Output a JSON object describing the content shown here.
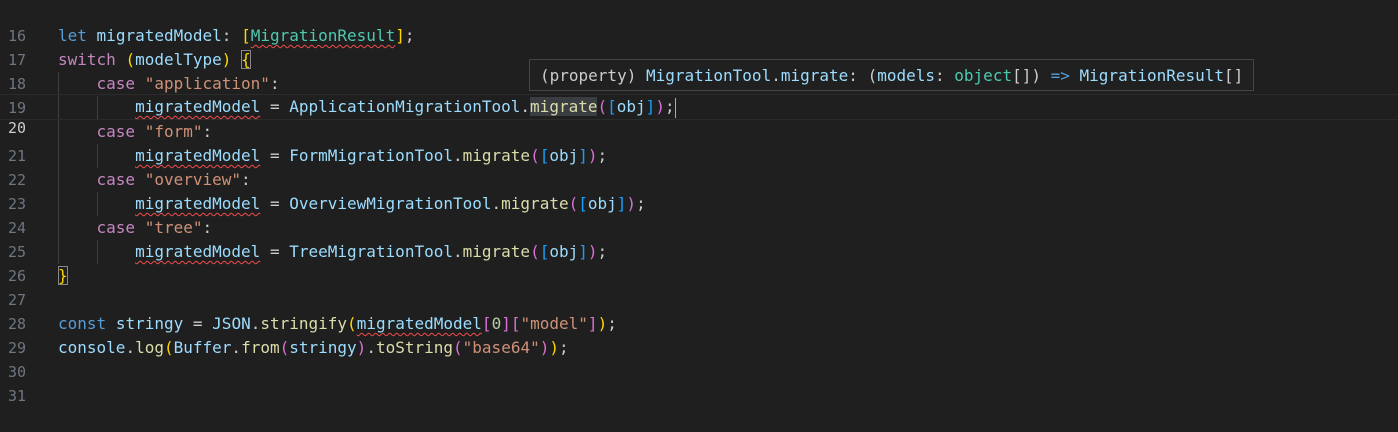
{
  "editor": {
    "current_line": "20",
    "lines": [
      {
        "num": "16"
      },
      {
        "num": "17",
        "t": {
          "kw": "let",
          "var": "migratedModel",
          "colon": ":",
          "ob": "[",
          "type": "MigrationResult",
          "cb": "]",
          "semi": ";"
        }
      },
      {
        "num": "18",
        "t": {
          "kw": "switch",
          "op": "(",
          "var": "modelType",
          "cp": ")",
          "brace": "{"
        }
      },
      {
        "num": "19",
        "t": {
          "kw": "case",
          "str": "\"application\"",
          "colon": ":"
        }
      },
      {
        "num": "20",
        "t": {
          "var": "migratedModel",
          "eq": "=",
          "obj": "ApplicationMigrationTool",
          "dot": ".",
          "fn": "migrate",
          "op": "(",
          "ob": "[",
          "arg": "obj",
          "cb": "]",
          "cp": ")",
          "semi": ";"
        }
      },
      {
        "num": "21",
        "t": {
          "kw": "case",
          "str": "\"form\"",
          "colon": ":"
        }
      },
      {
        "num": "22",
        "t": {
          "var": "migratedModel",
          "eq": "=",
          "obj": "FormMigrationTool",
          "dot": ".",
          "fn": "migrate",
          "op": "(",
          "ob": "[",
          "arg": "obj",
          "cb": "]",
          "cp": ")",
          "semi": ";"
        }
      },
      {
        "num": "23",
        "t": {
          "kw": "case",
          "str": "\"overview\"",
          "colon": ":"
        }
      },
      {
        "num": "24",
        "t": {
          "var": "migratedModel",
          "eq": "=",
          "obj": "OverviewMigrationTool",
          "dot": ".",
          "fn": "migrate",
          "op": "(",
          "ob": "[",
          "arg": "obj",
          "cb": "]",
          "cp": ")",
          "semi": ";"
        }
      },
      {
        "num": "25",
        "t": {
          "kw": "case",
          "str": "\"tree\"",
          "colon": ":"
        }
      },
      {
        "num": "26",
        "t": {
          "var": "migratedModel",
          "eq": "=",
          "obj": "TreeMigrationTool",
          "dot": ".",
          "fn": "migrate",
          "op": "(",
          "ob": "[",
          "arg": "obj",
          "cb": "]",
          "cp": ")",
          "semi": ";"
        }
      },
      {
        "num": "27",
        "t": {
          "brace": "}"
        }
      },
      {
        "num": "28"
      },
      {
        "num": "29",
        "t": {
          "kw": "const",
          "var": "stringy",
          "eq": "=",
          "obj": "JSON",
          "dot": ".",
          "fn": "stringify",
          "op": "(",
          "arg": "migratedModel",
          "ob1": "[",
          "num": "0",
          "cb1": "]",
          "ob2": "[",
          "str": "\"model\"",
          "cb2": "]",
          "cp": ")",
          "semi": ";"
        }
      },
      {
        "num": "30",
        "t": {
          "var": "console",
          "dot": ".",
          "fn": "log",
          "op": "(",
          "obj": "Buffer",
          "dot2": ".",
          "fn2": "from",
          "op2": "(",
          "arg": "stringy",
          "cp2": ")",
          "dot3": ".",
          "fn3": "toString",
          "op3": "(",
          "str": "\"base64\"",
          "cp3": ")",
          "cp": ")",
          "semi": ";"
        }
      },
      {
        "num": "31"
      }
    ]
  },
  "hover": {
    "kind": "(property)",
    "owner": "MigrationTool",
    "dot": ".",
    "name": "migrate",
    "colon1": ":",
    "open": "(",
    "param": "models",
    "colon2": ":",
    "ptype": "object",
    "arr": "[]",
    "close": ")",
    "arrow": "=>",
    "ret": "MigrationResult",
    "ret_arr": "[]"
  },
  "colors": {
    "background": "#1f1f1f",
    "keyword": "#569cd6",
    "control": "#c586c0",
    "variable": "#9cdcfe",
    "type": "#4ec9b0",
    "function": "#dcdcaa",
    "string": "#ce9178",
    "number": "#b5cea8",
    "error_squiggle": "#f14c4c"
  }
}
